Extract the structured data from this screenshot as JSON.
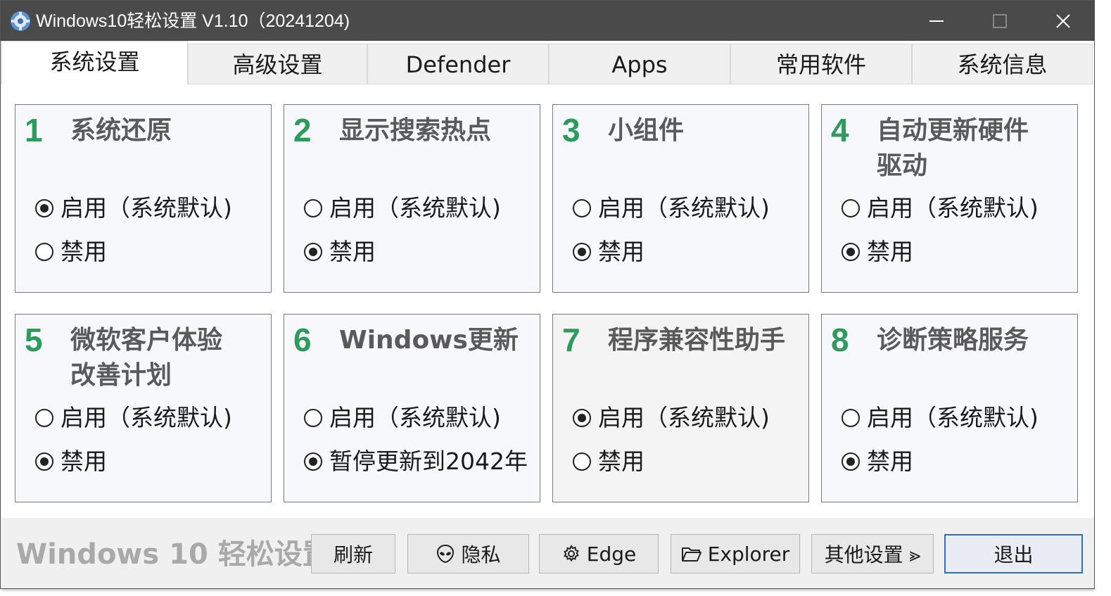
{
  "window": {
    "title": "Windows10轻松设置 V1.10（20241204)",
    "icon": "gear-icon",
    "controls": [
      "minimize-icon",
      "maximize-icon",
      "close-icon"
    ]
  },
  "tabs": [
    {
      "label": "系统设置",
      "active": true
    },
    {
      "label": "高级设置",
      "active": false
    },
    {
      "label": "Defender",
      "active": false
    },
    {
      "label": "Apps",
      "active": false
    },
    {
      "label": "常用软件",
      "active": false
    },
    {
      "label": "系统信息",
      "active": false
    }
  ],
  "cards": [
    {
      "num": "1",
      "title": "系统还原",
      "opt1": "启用（系统默认)",
      "opt2": "禁用",
      "selected": 1
    },
    {
      "num": "2",
      "title": "显示搜索热点",
      "opt1": "启用（系统默认)",
      "opt2": "禁用",
      "selected": 2
    },
    {
      "num": "3",
      "title": "小组件",
      "opt1": "启用（系统默认)",
      "opt2": "禁用",
      "selected": 2
    },
    {
      "num": "4",
      "title": "自动更新硬件驱动",
      "opt1": "启用（系统默认)",
      "opt2": "禁用",
      "selected": 2
    },
    {
      "num": "5",
      "title": "微软客户体验改善计划",
      "opt1": "启用（系统默认)",
      "opt2": "禁用",
      "selected": 2
    },
    {
      "num": "6",
      "title": "Windows更新",
      "opt1": "启用（系统默认)",
      "opt2": "暂停更新到2042年",
      "selected": 2
    },
    {
      "num": "7",
      "title": "程序兼容性助手",
      "opt1": "启用（系统默认)",
      "opt2": "禁用",
      "selected": 1
    },
    {
      "num": "8",
      "title": "诊断策略服务",
      "opt1": "启用（系统默认)",
      "opt2": "禁用",
      "selected": 2
    }
  ],
  "footer": {
    "brand": "Windows 10 轻松设置",
    "buttons": {
      "refresh": "刷新",
      "privacy": "隐私",
      "edge": "Edge",
      "explorer": "Explorer",
      "other": "其他设置 ⪢",
      "exit": "退出"
    },
    "icons": {
      "privacy": "alien-icon",
      "edge": "gear-icon",
      "explorer": "folder-icon"
    }
  },
  "colors": {
    "number": "#2e9b5c",
    "titlebar": "#4a4a4a",
    "primary_border": "#2f6fc6"
  }
}
